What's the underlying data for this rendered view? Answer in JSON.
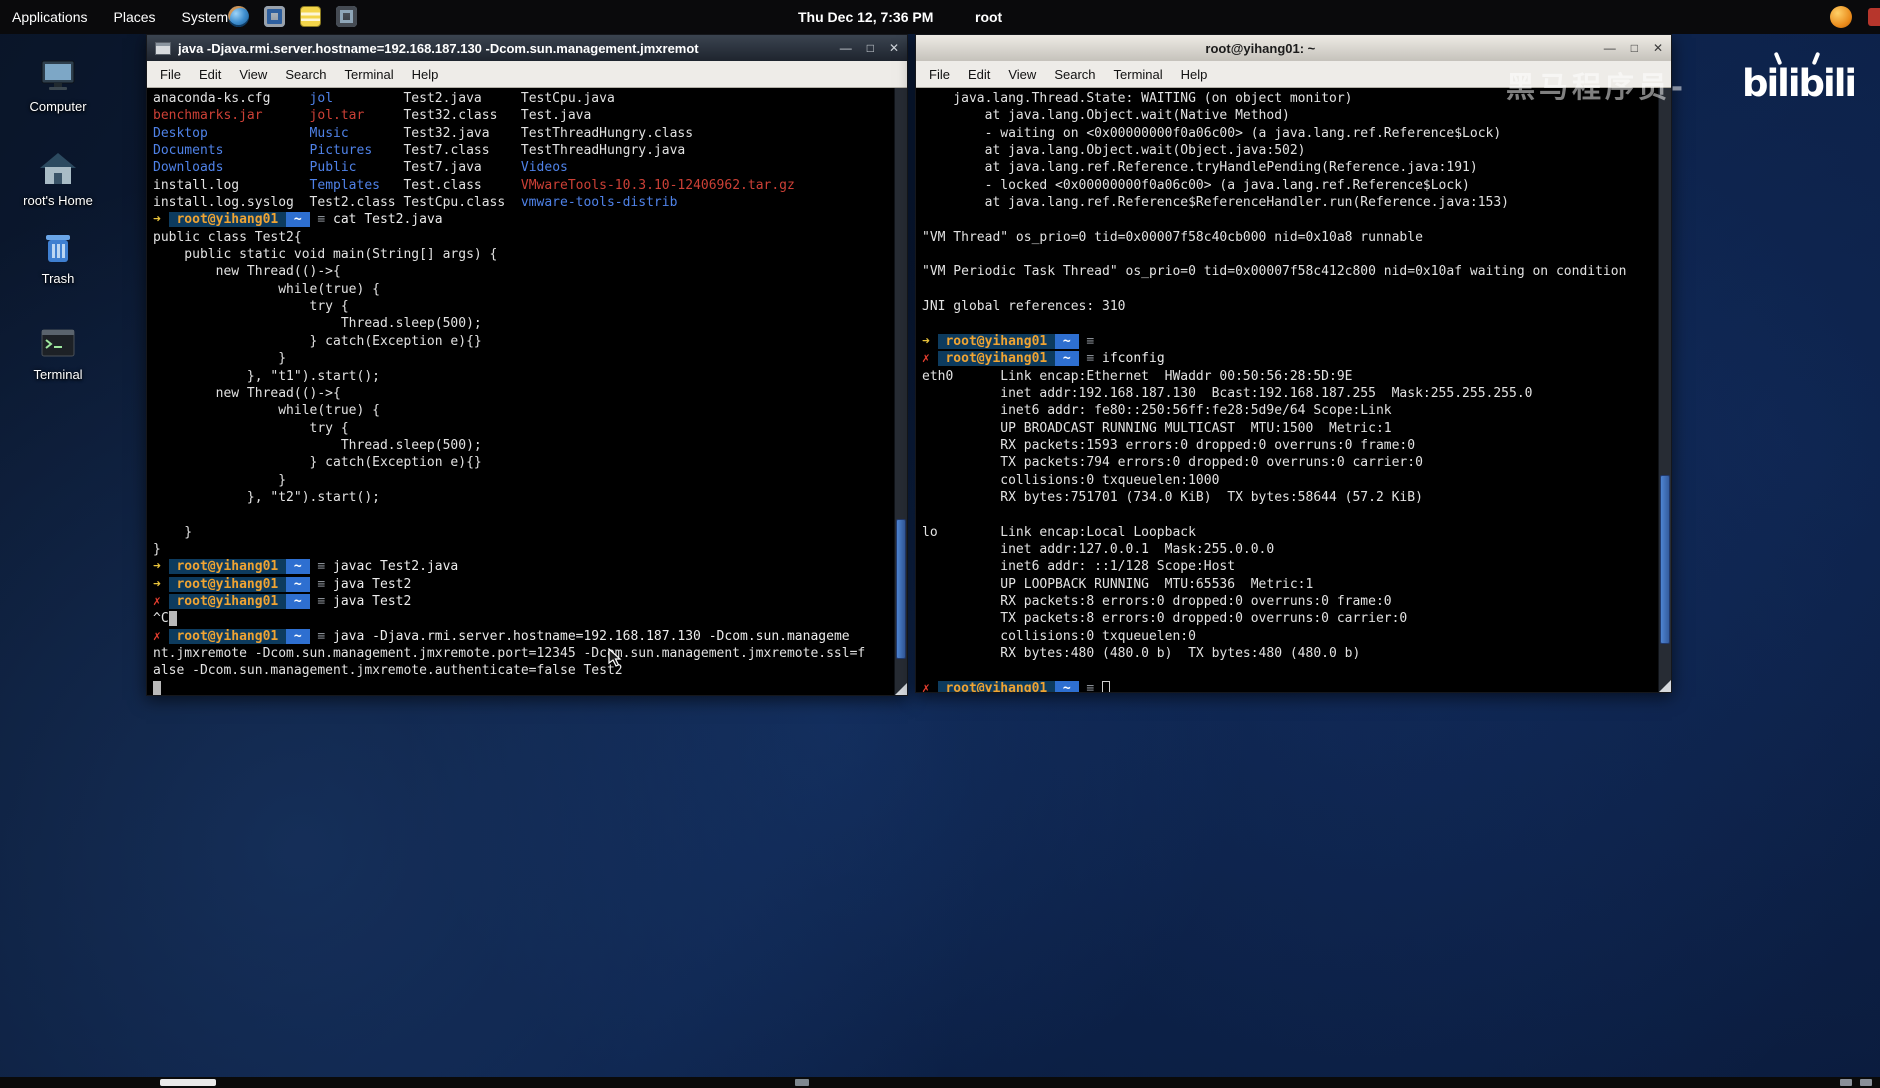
{
  "top_panel": {
    "menus": [
      "Applications",
      "Places",
      "System"
    ],
    "clock": "Thu Dec 12, 7:36 PM",
    "user": "root",
    "tray_icons": [
      "firefox-icon",
      "display-icon",
      "notes-icon",
      "screenshot-icon"
    ],
    "notification_icon": "orange-status-icon"
  },
  "desktop": {
    "icons": [
      {
        "label": "Computer",
        "icon": "computer-icon"
      },
      {
        "label": "root's Home",
        "icon": "home-icon"
      },
      {
        "label": "Trash",
        "icon": "trash-icon"
      },
      {
        "label": "Terminal",
        "icon": "terminal-icon"
      }
    ]
  },
  "window_controls": {
    "minimize": "—",
    "maximize": "□",
    "close": "✕"
  },
  "prompt": {
    "user": "root@yihang01",
    "dir": "~",
    "sep": "≡",
    "ok_mark": "➜",
    "err_mark": "✗"
  },
  "left_window": {
    "title": "java -Djava.rmi.server.hostname=192.168.187.130 -Dcom.sun.management.jmxremot",
    "menu": [
      "File",
      "Edit",
      "View",
      "Search",
      "Terminal",
      "Help"
    ],
    "lines": [
      {
        "s": [
          [
            "anaconda-ks.cfg     ",
            "t-def"
          ],
          [
            "jol",
            "t-dir"
          ],
          [
            "         Test2.java     TestCpu.java",
            "t-def"
          ]
        ]
      },
      {
        "s": [
          [
            "benchmarks.jar",
            "t-red"
          ],
          [
            "      ",
            "t-def"
          ],
          [
            "jol.tar",
            "t-red"
          ],
          [
            "     Test32.class   Test.java",
            "t-def"
          ]
        ]
      },
      {
        "s": [
          [
            "Desktop",
            "t-dir"
          ],
          [
            "             ",
            "t-def"
          ],
          [
            "Music",
            "t-dir"
          ],
          [
            "       Test32.java    TestThreadHungry.class",
            "t-def"
          ]
        ]
      },
      {
        "s": [
          [
            "Documents",
            "t-dir"
          ],
          [
            "           ",
            "t-def"
          ],
          [
            "Pictures",
            "t-dir"
          ],
          [
            "    Test7.class    TestThreadHungry.java",
            "t-def"
          ]
        ]
      },
      {
        "s": [
          [
            "Downloads",
            "t-dir"
          ],
          [
            "           ",
            "t-def"
          ],
          [
            "Public",
            "t-dir"
          ],
          [
            "      Test7.java     ",
            "t-def"
          ],
          [
            "Videos",
            "t-dir"
          ]
        ]
      },
      {
        "s": [
          [
            "install.log         ",
            "t-def"
          ],
          [
            "Templates",
            "t-dir"
          ],
          [
            "   Test.class     ",
            "t-def"
          ],
          [
            "VMwareTools-10.3.10-12406962.tar.gz",
            "t-red"
          ]
        ]
      },
      {
        "s": [
          [
            "install.log.syslog  Test2.class TestCpu.class  ",
            "t-def"
          ],
          [
            "vmware-tools-distrib",
            "t-dir"
          ]
        ]
      },
      {
        "p": {
          "st": "ok",
          "cmd": "cat Test2.java"
        }
      },
      "public class Test2{",
      "    public static void main(String[] args) {",
      "        new Thread(()->{",
      "                while(true) {",
      "                    try {",
      "                        Thread.sleep(500);",
      "                    } catch(Exception e){}",
      "                }",
      "            }, \"t1\").start();",
      "        new Thread(()->{",
      "                while(true) {",
      "                    try {",
      "                        Thread.sleep(500);",
      "                    } catch(Exception e){}",
      "                }",
      "            }, \"t2\").start();",
      "",
      "    }",
      "}",
      {
        "p": {
          "st": "ok",
          "cmd": "javac Test2.java"
        }
      },
      {
        "p": {
          "st": "ok",
          "cmd": "java Test2"
        }
      },
      {
        "p": {
          "st": "err",
          "cmd": "java Test2"
        }
      },
      {
        "s": [
          [
            "^C",
            "t-def"
          ],
          [
            " ",
            "blk"
          ]
        ]
      },
      {
        "p": {
          "st": "err",
          "cmd": "java -Djava.rmi.server.hostname=192.168.187.130 -Dcom.sun.manageme"
        }
      },
      "nt.jmxremote -Dcom.sun.management.jmxremote.port=12345 -Dcom.sun.management.jmxremote.ssl=f",
      "alse -Dcom.sun.management.jmxremote.authenticate=false Test2",
      {
        "c": 1
      }
    ]
  },
  "right_window": {
    "title": "root@yihang01: ~",
    "menu": [
      "File",
      "Edit",
      "View",
      "Search",
      "Terminal",
      "Help"
    ],
    "lines": [
      "    java.lang.Thread.State: WAITING (on object monitor)",
      "        at java.lang.Object.wait(Native Method)",
      "        - waiting on <0x00000000f0a06c00> (a java.lang.ref.Reference$Lock)",
      "        at java.lang.Object.wait(Object.java:502)",
      "        at java.lang.ref.Reference.tryHandlePending(Reference.java:191)",
      "        - locked <0x00000000f0a06c00> (a java.lang.ref.Reference$Lock)",
      "        at java.lang.ref.Reference$ReferenceHandler.run(Reference.java:153)",
      "",
      "\"VM Thread\" os_prio=0 tid=0x00007f58c40cb000 nid=0x10a8 runnable",
      "",
      "\"VM Periodic Task Thread\" os_prio=0 tid=0x00007f58c412c800 nid=0x10af waiting on condition",
      "",
      "JNI global references: 310",
      "",
      {
        "p": {
          "st": "ok",
          "cmd": ""
        }
      },
      {
        "p": {
          "st": "err",
          "cmd": "ifconfig"
        }
      },
      "eth0      Link encap:Ethernet  HWaddr 00:50:56:28:5D:9E",
      "          inet addr:192.168.187.130  Bcast:192.168.187.255  Mask:255.255.255.0",
      "          inet6 addr: fe80::250:56ff:fe28:5d9e/64 Scope:Link",
      "          UP BROADCAST RUNNING MULTICAST  MTU:1500  Metric:1",
      "          RX packets:1593 errors:0 dropped:0 overruns:0 frame:0",
      "          TX packets:794 errors:0 dropped:0 overruns:0 carrier:0",
      "          collisions:0 txqueuelen:1000",
      "          RX bytes:751701 (734.0 KiB)  TX bytes:58644 (57.2 KiB)",
      "",
      "lo        Link encap:Local Loopback",
      "          inet addr:127.0.0.1  Mask:255.0.0.0",
      "          inet6 addr: ::1/128 Scope:Host",
      "          UP LOOPBACK RUNNING  MTU:65536  Metric:1",
      "          RX packets:8 errors:0 dropped:0 overruns:0 frame:0",
      "          TX packets:8 errors:0 dropped:0 overruns:0 carrier:0",
      "          collisions:0 txqueuelen:0",
      "          RX bytes:480 (480.0 b)  TX bytes:480 (480.0 b)",
      "",
      {
        "p": {
          "st": "err",
          "cmd": "",
          "hollow": true
        }
      }
    ]
  },
  "watermarks": {
    "brand": "bilibili",
    "text": "黑马程序员-"
  }
}
